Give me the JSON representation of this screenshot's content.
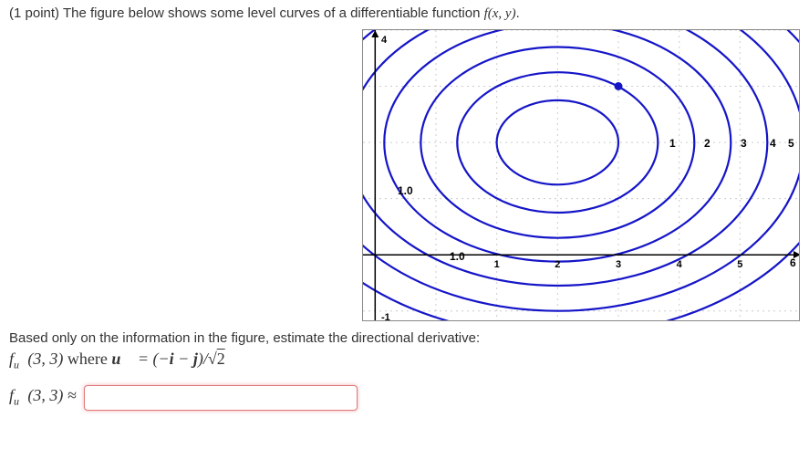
{
  "problem": {
    "points_label": "(1 point)",
    "intro_text": "The figure below shows some level curves of a differentiable function",
    "fn_symbol": "f(x, y)",
    "period": "."
  },
  "prompt2": "Based only on the information in the figure, estimate the directional derivative:",
  "derivative_line": {
    "fu_at": "f",
    "sub": "u⃗",
    "point": "(3, 3)",
    "where": " where ",
    "u_eq": "u⃗ = (−i − j)/√2"
  },
  "answer": {
    "label_f": "f",
    "label_sub": "u⃗",
    "label_point": "(3, 3) ≈",
    "value": ""
  },
  "chart_data": {
    "type": "contour",
    "title": "",
    "xlabel": "",
    "ylabel": "",
    "xlim": [
      -1.2,
      6
    ],
    "ylim": [
      -1.2,
      4
    ],
    "x_axis_origin_y": 0,
    "y_axis_origin_x": -1,
    "x_ticks": [
      1,
      2,
      3,
      4,
      5,
      6
    ],
    "y_ticks": [
      -1,
      4
    ],
    "labeled_contours": [
      {
        "level": 1.0,
        "label_pos": [
          -1,
          1.12
        ]
      },
      {
        "level": 1.0,
        "label_pos": [
          0.35,
          0
        ]
      }
    ],
    "center": [
      2,
      2
    ],
    "ellipses": [
      {
        "rx": 1.0,
        "ry": 0.75
      },
      {
        "rx": 1.65,
        "ry": 1.25
      },
      {
        "rx": 2.25,
        "ry": 1.7
      },
      {
        "rx": 2.85,
        "ry": 2.12
      },
      {
        "rx": 3.45,
        "ry": 2.55
      },
      {
        "rx": 4.05,
        "ry": 3.0
      },
      {
        "rx": 4.65,
        "ry": 3.45
      }
    ],
    "marker_point": [
      3,
      3
    ],
    "level_label_6": {
      "pos": [
        6,
        0
      ],
      "text": "6"
    }
  }
}
